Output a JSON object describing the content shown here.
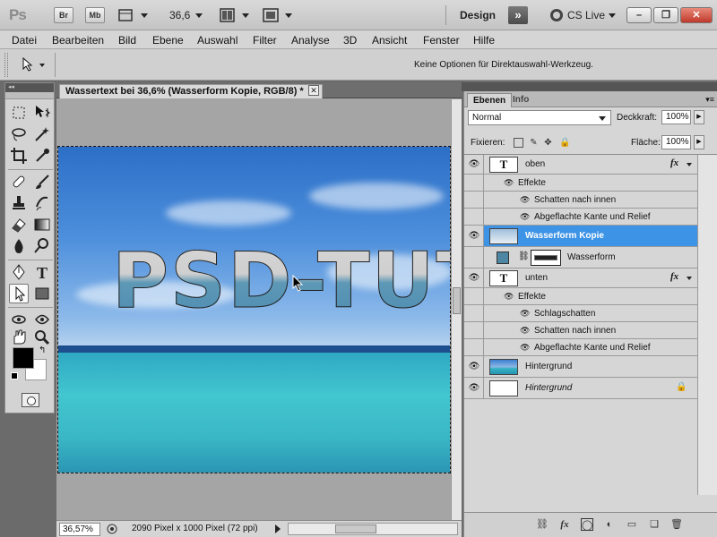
{
  "app": {
    "logo": "Ps",
    "buttons": [
      "Br",
      "Mb"
    ],
    "zoom": "36,6",
    "workspace": "Design",
    "workspace_more": "»",
    "cslive": "CS Live"
  },
  "menu": [
    "Datei",
    "Bearbeiten",
    "Bild",
    "Ebene",
    "Auswahl",
    "Filter",
    "Analyse",
    "3D",
    "Ansicht",
    "Fenster",
    "Hilfe"
  ],
  "options_text": "Keine Optionen für Direktauswahl-Werkzeug.",
  "document": {
    "tab_title": "Wassertext bei 36,6% (Wasserform Kopie, RGB/8) *",
    "canvas_text": "PSD-TUTO",
    "zoom_field": "36,57%",
    "status": "2090 Pixel x 1000 Pixel (72 ppi)"
  },
  "panel": {
    "tabs": [
      "Ebenen",
      "Info"
    ],
    "blend_mode": "Normal",
    "opacity_label": "Deckkraft:",
    "opacity_value": "100%",
    "lock_label": "Fixieren:",
    "fill_label": "Fläche:",
    "fill_value": "100%",
    "fx_label": "fx"
  },
  "layers": [
    {
      "name": "oben",
      "kind": "text",
      "fx": true
    },
    {
      "name": "Effekte",
      "kind": "effects-header"
    },
    {
      "name": "Schatten nach innen",
      "kind": "effect"
    },
    {
      "name": "Abgeflachte Kante und Relief",
      "kind": "effect"
    },
    {
      "name": "Wasserform Kopie",
      "kind": "image",
      "selected": true
    },
    {
      "name": "Wasserform",
      "kind": "shape"
    },
    {
      "name": "unten",
      "kind": "text",
      "fx": true
    },
    {
      "name": "Effekte",
      "kind": "effects-header"
    },
    {
      "name": "Schlagschatten",
      "kind": "effect"
    },
    {
      "name": "Schatten nach innen",
      "kind": "effect"
    },
    {
      "name": "Abgeflachte Kante und Relief",
      "kind": "effect"
    },
    {
      "name": "Hintergrund",
      "kind": "image"
    },
    {
      "name": "Hintergrund",
      "kind": "background",
      "locked": true
    }
  ],
  "colors": {
    "selected_row": "#3d93e5",
    "foreground": "#000000",
    "background": "#ffffff"
  }
}
